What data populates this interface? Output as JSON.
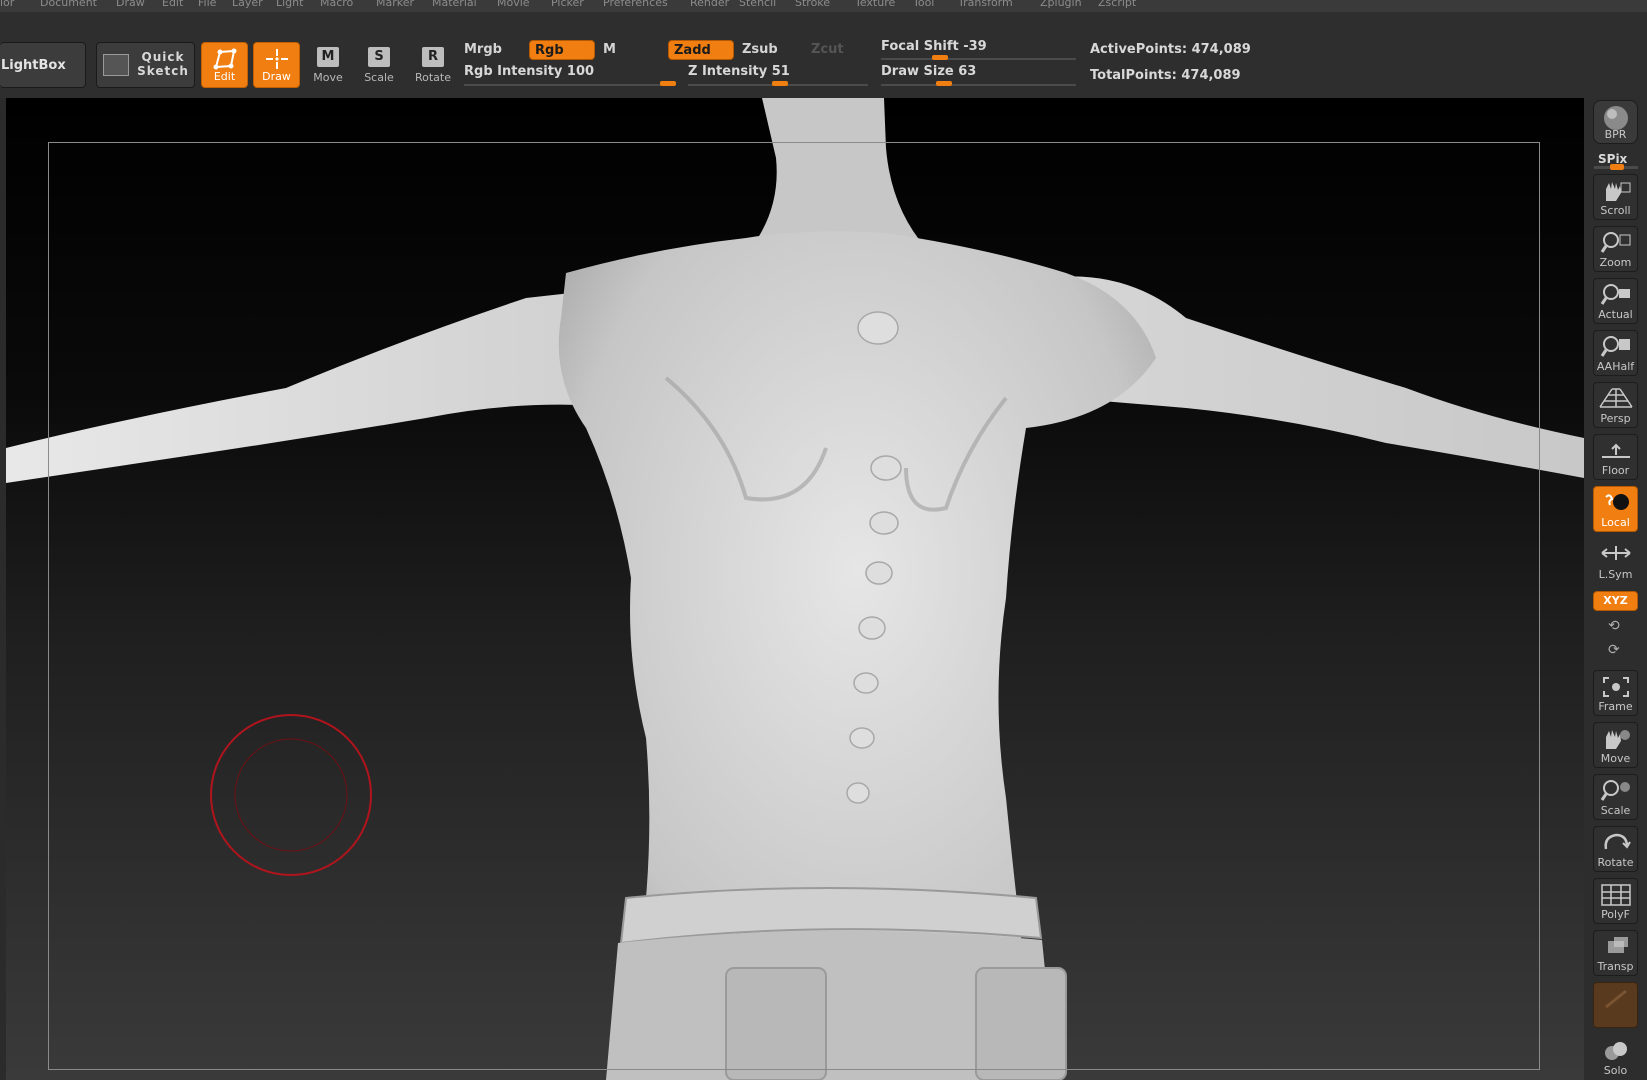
{
  "menu": [
    "lor",
    "Document",
    "Draw",
    "Edit",
    "File",
    "Layer",
    "Light",
    "Macro",
    "Marker",
    "Material",
    "Movie",
    "Picker",
    "Preferences",
    "Render",
    "Stencil",
    "Stroke",
    "Texture",
    "Tool",
    "Transform",
    "Zplugin",
    "Zscript"
  ],
  "toolbar": {
    "lightbox": "LightBox",
    "quick_sketch": "Quick Sketch",
    "edit": "Edit",
    "draw": "Draw",
    "move": "Move",
    "scale": "Scale",
    "rotate": "Rotate",
    "move_key": "M",
    "scale_key": "S",
    "rotate_key": "R",
    "mrgb": "Mrgb",
    "rgb": "Rgb",
    "m": "M",
    "zadd": "Zadd",
    "zsub": "Zsub",
    "zcut": "Zcut",
    "rgb_intensity": "Rgb Intensity 100",
    "z_intensity": "Z Intensity 51",
    "focal_shift": "Focal Shift -39",
    "draw_size": "Draw Size 63",
    "active_points": "ActivePoints: 474,089",
    "total_points": "TotalPoints: 474,089",
    "rgb_intensity_value": 100,
    "z_intensity_value": 51,
    "focal_shift_value": -39,
    "draw_size_value": 63
  },
  "shelf": {
    "bpr": "BPR",
    "spix": "SPix",
    "scroll": "Scroll",
    "zoom": "Zoom",
    "actual": "Actual",
    "aahalf": "AAHalf",
    "persp": "Persp",
    "floor": "Floor",
    "local": "Local",
    "lsym": "L.Sym",
    "xyz": "XYZ",
    "frame": "Frame",
    "move": "Move",
    "scale": "Scale",
    "rotate": "Rotate",
    "polyf": "PolyF",
    "transp": "Transp",
    "solo": "Solo"
  },
  "colors": {
    "accent": "#f07e10",
    "panel": "#2e2e2e",
    "brush_cursor": "#b0141c"
  }
}
